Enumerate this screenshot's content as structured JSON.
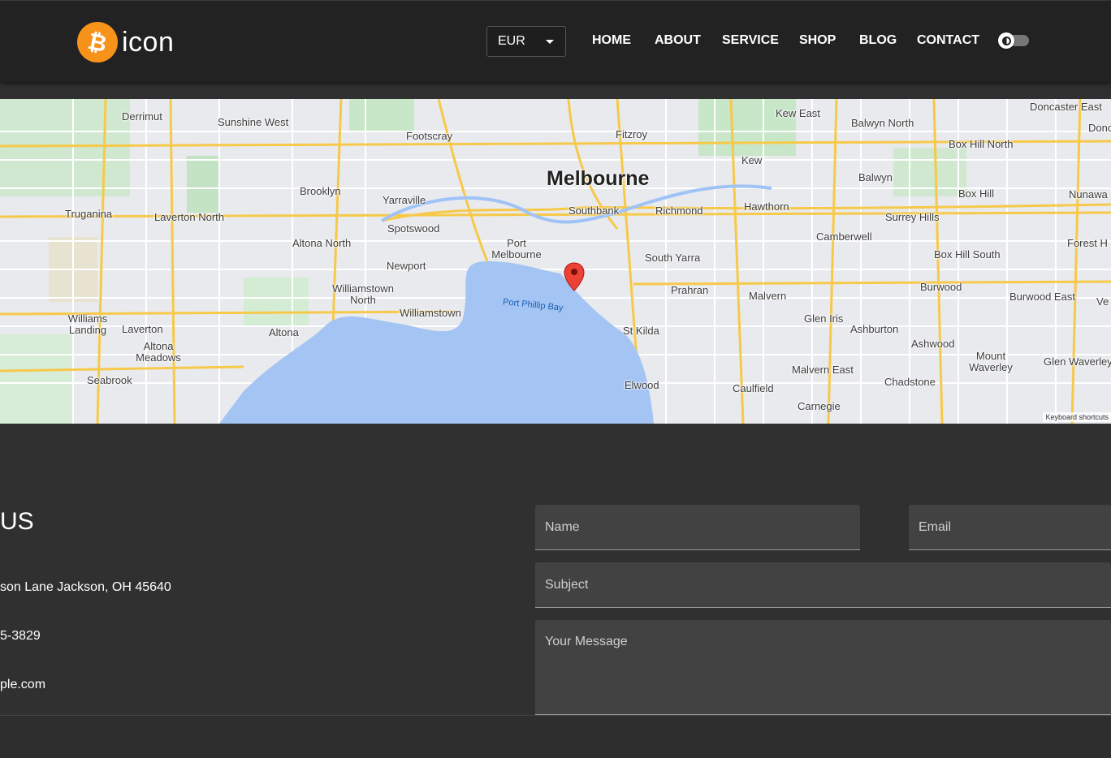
{
  "header": {
    "logo_symbol": "₿",
    "logo_text": "icon",
    "currency": "EUR",
    "nav": [
      "HOME",
      "ABOUT",
      "SERVICE",
      "SHOP",
      "BLOG",
      "CONTACT"
    ],
    "theme_toggle_icon": "half-moon-icon",
    "brand_color": "#f7931a"
  },
  "map": {
    "city": "Melbourne",
    "water": "Port Phillip Bay",
    "keyboard_shortcuts": "Keyboard shortcuts",
    "places": [
      "Derrimut",
      "Sunshine West",
      "Footscray",
      "Fitzroy",
      "Kew East",
      "Balwyn North",
      "Doncaster East",
      "Box Hill North",
      "Kew",
      "Balwyn",
      "Box Hill",
      "Nunawa",
      "Brooklyn",
      "Yarraville",
      "Southbank",
      "Richmond",
      "Hawthorn",
      "Surrey Hills",
      "Truganina",
      "Laverton North",
      "Spotswood",
      "Camberwell",
      "Forest H",
      "Altona North",
      "Port Melbourne",
      "South Yarra",
      "Box Hill South",
      "Newport",
      "Burwood",
      "Williamstown North",
      "Prahran",
      "Malvern",
      "Burwood East",
      "Williamstown",
      "Williams Landing",
      "Laverton",
      "Altona",
      "Glen Iris",
      "Ashburton",
      "St Kilda",
      "Ashwood",
      "Altona Meadows",
      "Mount Waverley",
      "Glen Waverley",
      "Seabrook",
      "Malvern East",
      "Chadstone",
      "Elwood",
      "Caulfield",
      "Carnegie",
      "Donc",
      "Ve"
    ],
    "pin_color": "#ea4335"
  },
  "contact": {
    "title": "US",
    "address": "son Lane Jackson, OH 45640",
    "phone": "5-3829",
    "email": "ple.com",
    "form": {
      "name_placeholder": "Name",
      "email_placeholder": "Email",
      "subject_placeholder": "Subject",
      "message_placeholder": "Your Message"
    }
  }
}
